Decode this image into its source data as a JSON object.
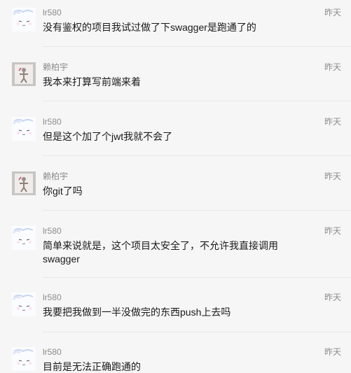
{
  "messages": [
    {
      "sender": "lr580",
      "time": "昨天",
      "text": "没有鉴权的项目我试过做了下swagger是跑通了的",
      "avatar": "anime-face-icon"
    },
    {
      "sender": "赖柏宇",
      "time": "昨天",
      "text": "我本来打算写前端来着",
      "avatar": "figure-photo-icon"
    },
    {
      "sender": "lr580",
      "time": "昨天",
      "text": "但是这个加了个jwt我就不会了",
      "avatar": "anime-face-icon"
    },
    {
      "sender": "赖柏宇",
      "time": "昨天",
      "text": "你git了吗",
      "avatar": "figure-photo-icon"
    },
    {
      "sender": "lr580",
      "time": "昨天",
      "text": "简单来说就是，这个项目太安全了，不允许我直接调用swagger",
      "avatar": "anime-face-icon"
    },
    {
      "sender": "lr580",
      "time": "昨天",
      "text": "我要把我做到一半没做完的东西push上去吗",
      "avatar": "anime-face-icon"
    },
    {
      "sender": "lr580",
      "time": "昨天",
      "text": "目前是无法正确跑通的",
      "avatar": "anime-face-icon"
    }
  ]
}
